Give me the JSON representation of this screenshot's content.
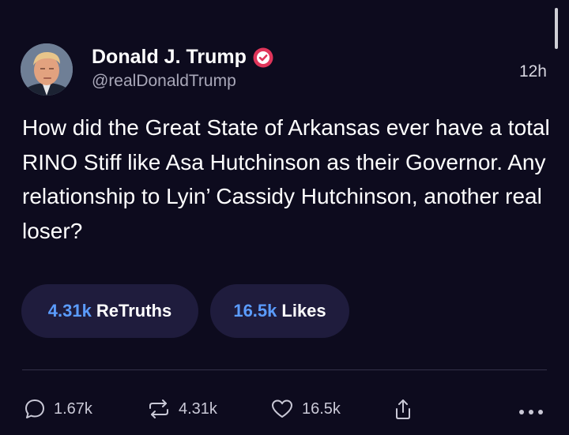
{
  "post": {
    "display_name": "Donald J. Trump",
    "handle": "@realDonaldTrump",
    "timestamp": "12h",
    "verified": true,
    "text": "How did the Great State of Arkansas ever have a total RINO Stiff like Asa Hutchinson as their Governor. Any relationship to Lyin’ Cassidy Hutchinson, another real loser?"
  },
  "stats": {
    "retruths_count": "4.31k",
    "retruths_label": "ReTruths",
    "likes_count": "16.5k",
    "likes_label": "Likes"
  },
  "actions": {
    "replies": "1.67k",
    "retruths": "4.31k",
    "likes": "16.5k"
  },
  "icons": {
    "reply": "reply-icon",
    "retruth": "retruth-icon",
    "like": "heart-icon",
    "share": "share-icon",
    "more": "more-icon",
    "verified": "verified-badge-icon"
  },
  "colors": {
    "background": "#0d0b1e",
    "pill_background": "#1f1c3d",
    "accent_blue": "#5b9cff",
    "verified_badge": "#e0355a"
  }
}
